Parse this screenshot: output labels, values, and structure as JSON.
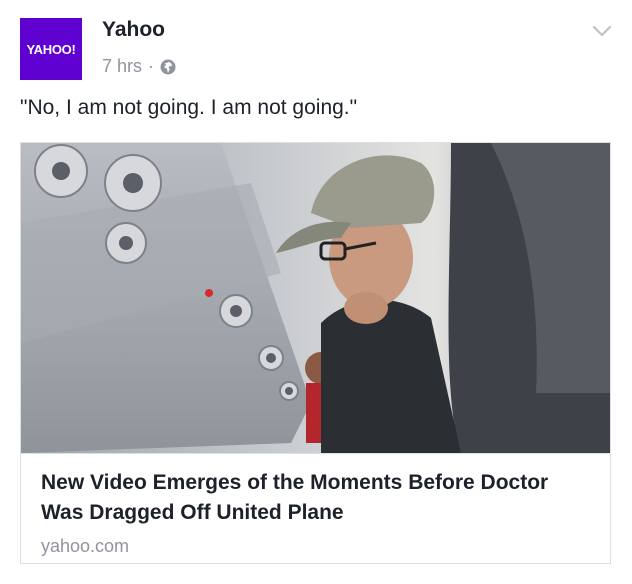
{
  "post": {
    "author": "Yahoo",
    "avatar_logo_text": "YAHOO!",
    "time": "7 hrs",
    "separator": "·",
    "privacy_icon": "globe-icon",
    "menu_icon": "chevron-down-icon",
    "message": "\"No, I am not going. I am not going.\""
  },
  "link_card": {
    "title": "New Video Emerges of the Moments Before Doctor Was Dragged Off United Plane",
    "domain": "yahoo.com"
  },
  "colors": {
    "brand": "#5f01d1",
    "text": "#1d2129",
    "secondary_text": "#90949c",
    "border": "#dddfe2"
  }
}
